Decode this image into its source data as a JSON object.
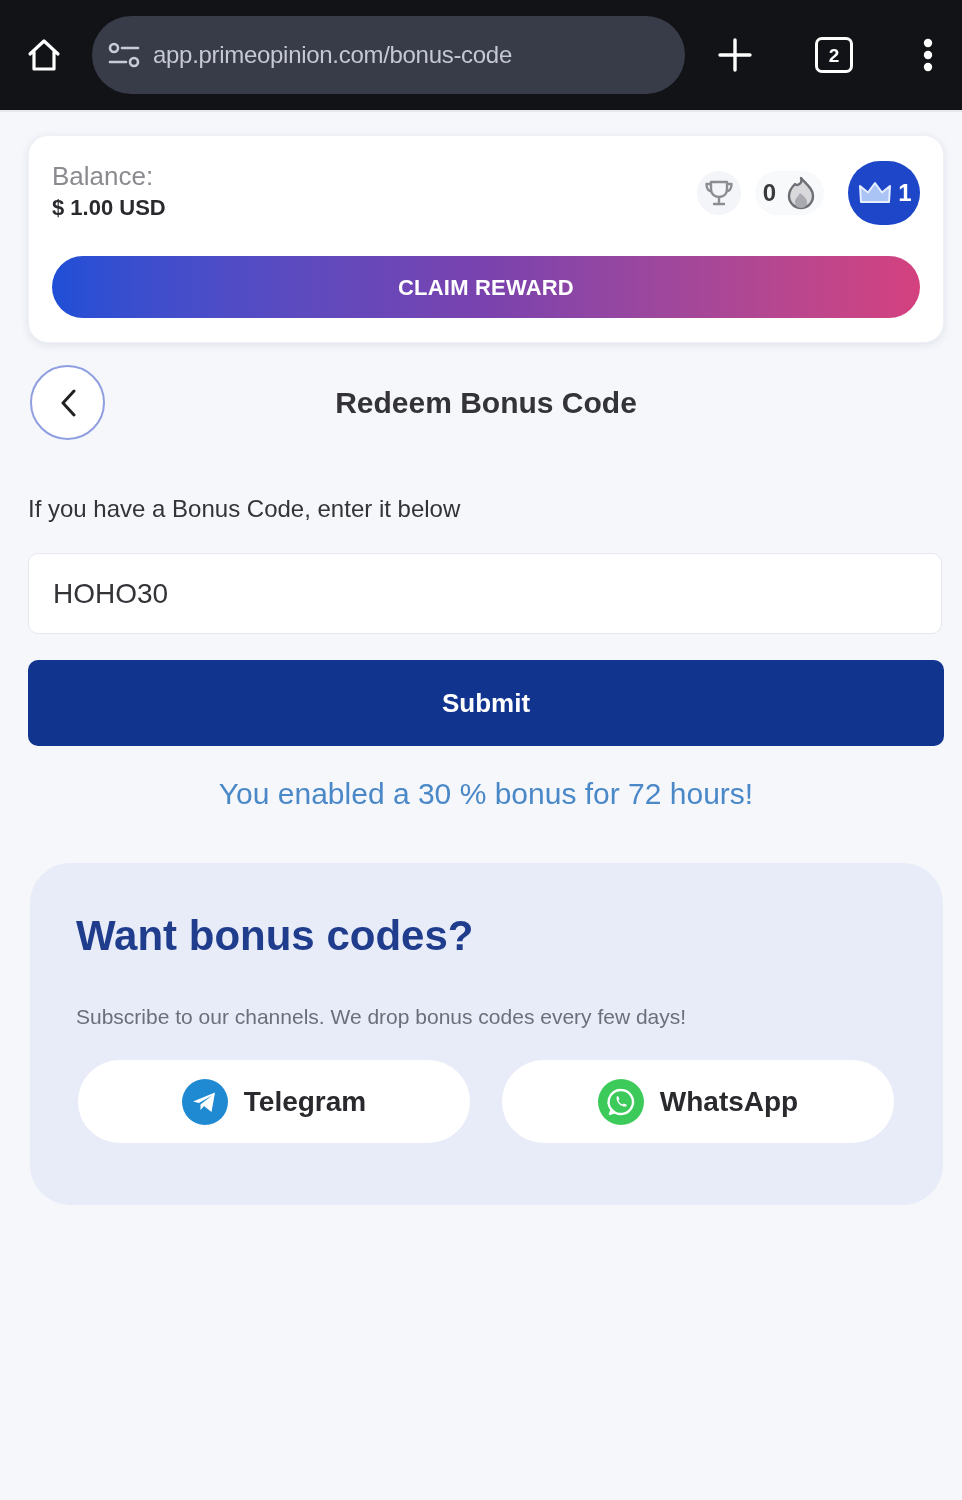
{
  "browser": {
    "url": "app.primeopinion.com/bonus-code",
    "tab_count": "2"
  },
  "header": {
    "balance_label": "Balance:",
    "balance_value": "$ 1.00 USD",
    "streak": "0",
    "level": "1",
    "claim_button": "CLAIM REWARD"
  },
  "page": {
    "title": "Redeem Bonus Code",
    "prompt": "If you have a Bonus Code, enter it below",
    "code_field": {
      "value": "HOHO30"
    },
    "submit_button": "Submit",
    "message": "You enabled a 30 % bonus for 72 hours!"
  },
  "promo": {
    "heading": "Want bonus codes?",
    "text": "Subscribe to our channels. We drop bonus codes every few days!",
    "channels": [
      {
        "kind": "telegram",
        "label": "Telegram"
      },
      {
        "kind": "whatsapp",
        "label": "WhatsApp"
      }
    ]
  }
}
